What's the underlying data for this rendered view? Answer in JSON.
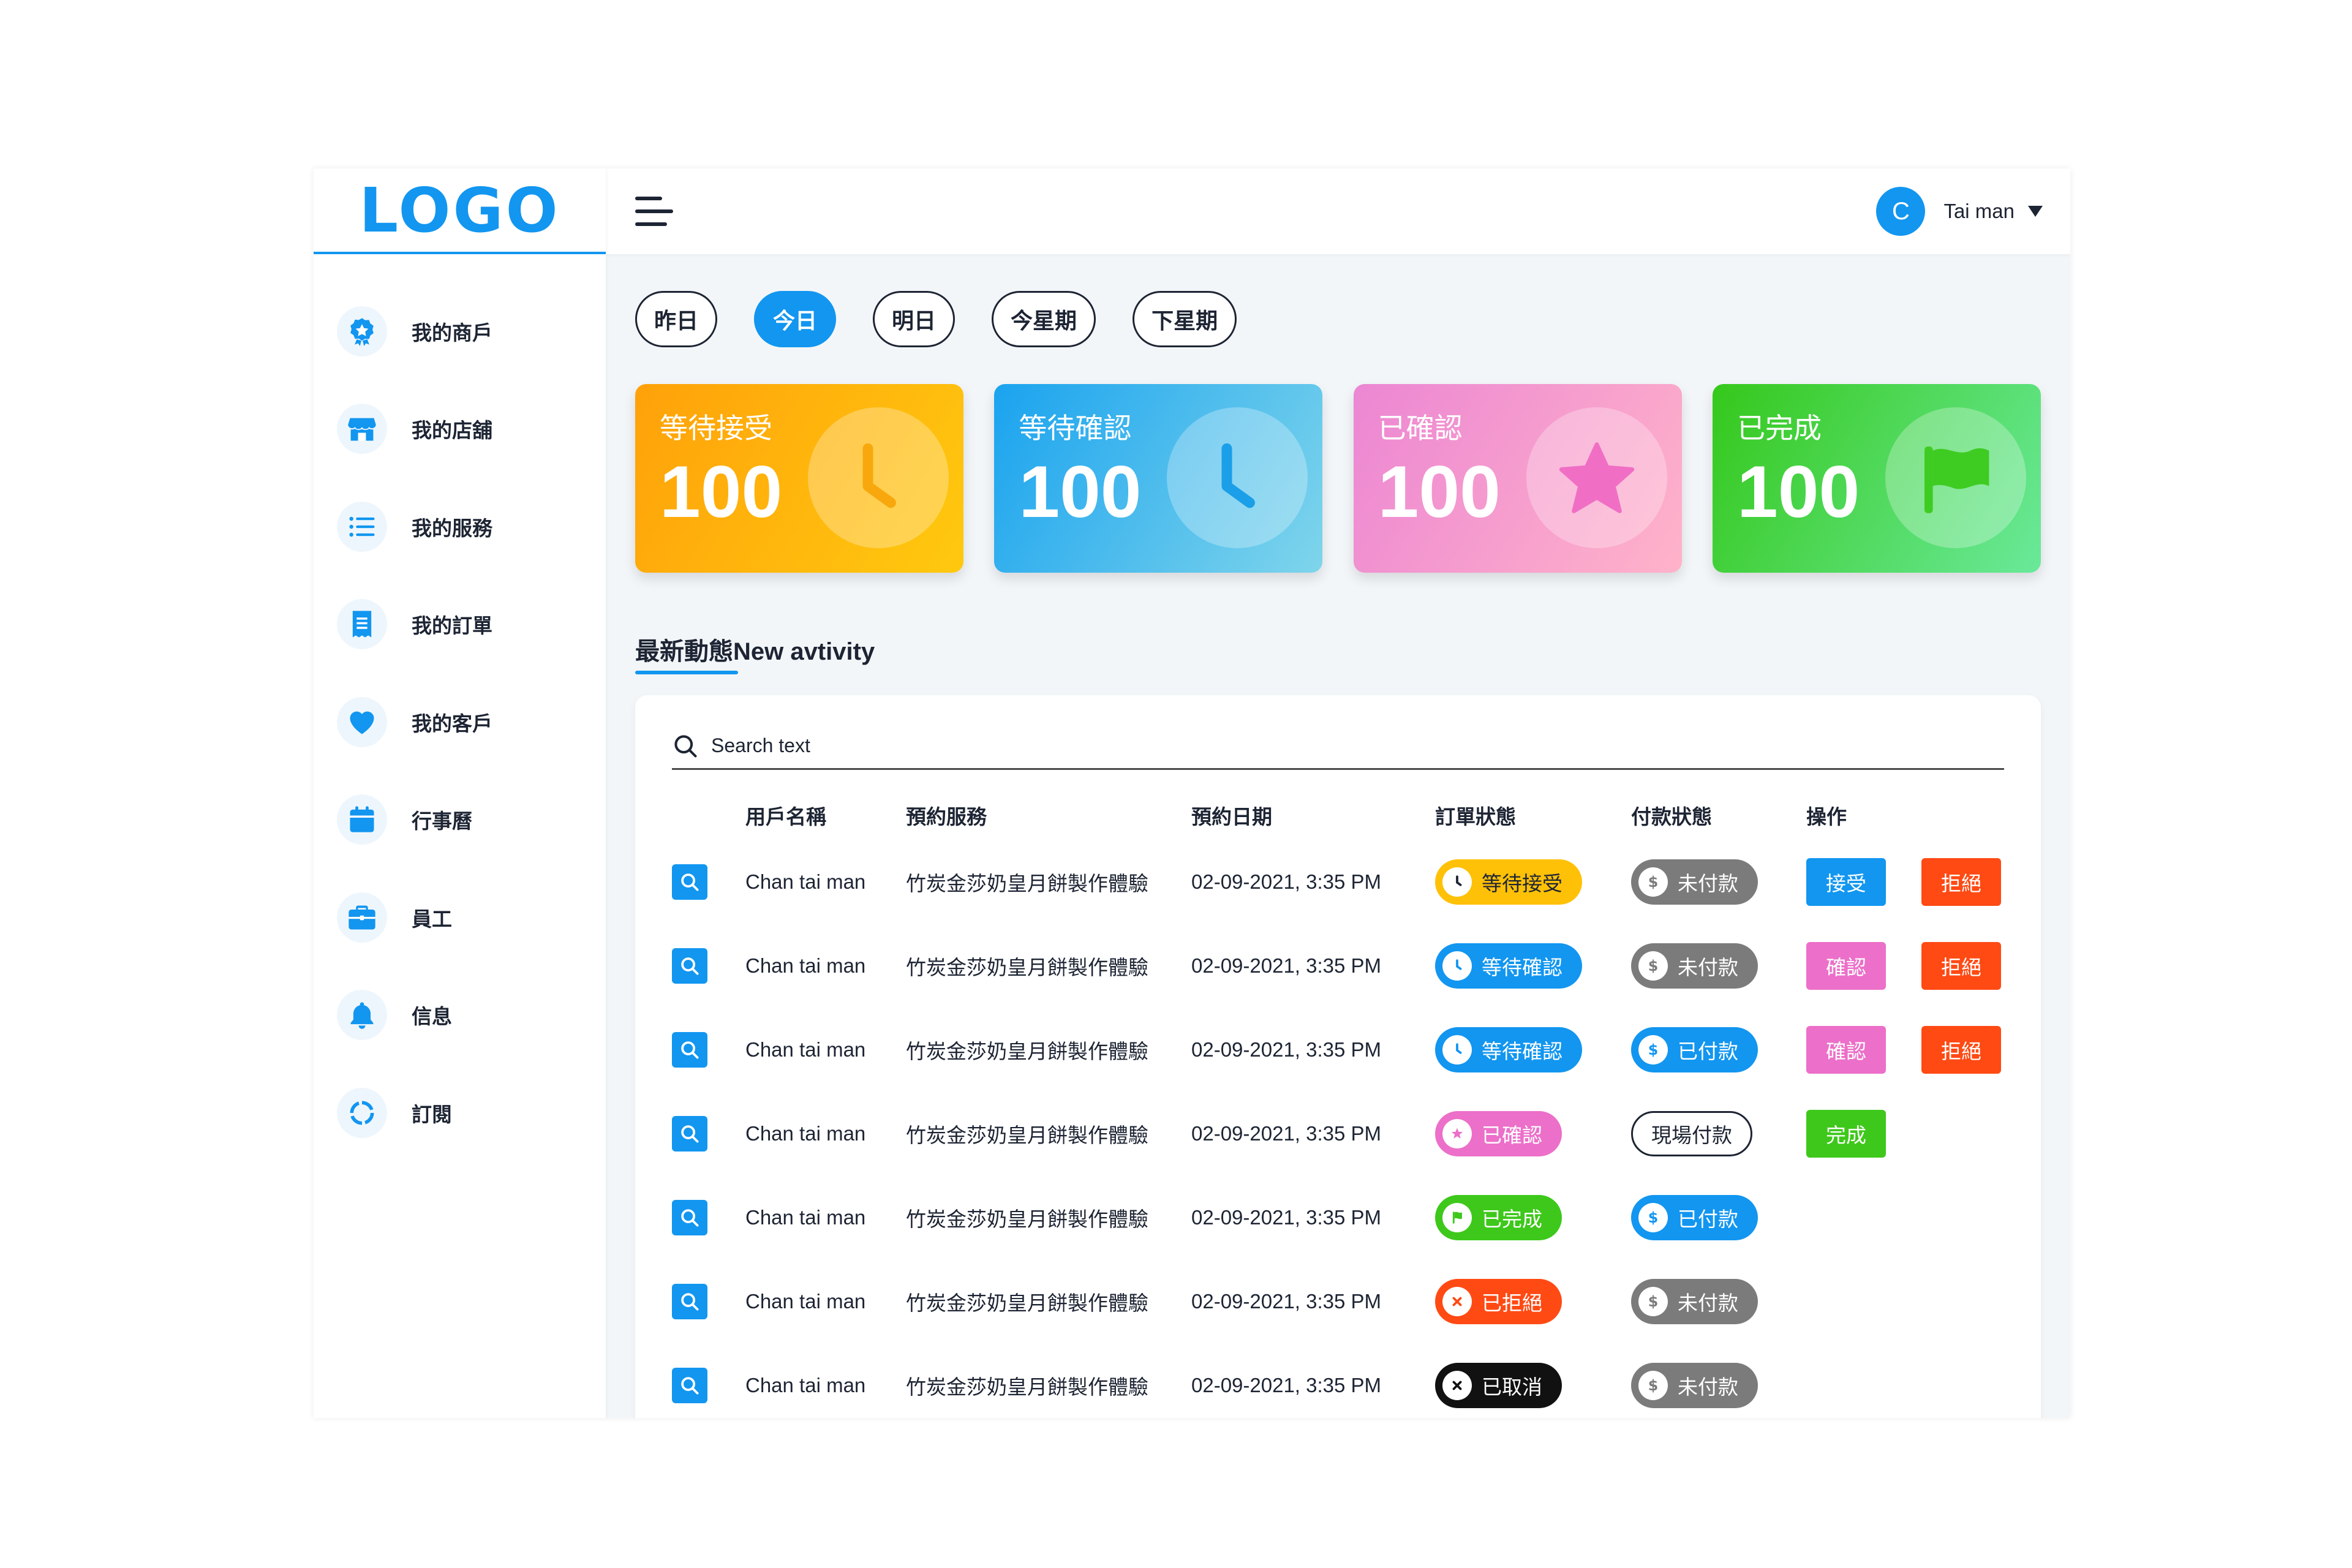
{
  "brand": {
    "logo": "LOGO"
  },
  "sidebar": {
    "items": [
      {
        "label": "我的商戶",
        "icon": "badge-icon"
      },
      {
        "label": "我的店舖",
        "icon": "store-icon"
      },
      {
        "label": "我的服務",
        "icon": "list-icon"
      },
      {
        "label": "我的訂單",
        "icon": "receipt-icon"
      },
      {
        "label": "我的客戶",
        "icon": "heart-icon"
      },
      {
        "label": "行事曆",
        "icon": "calendar-icon"
      },
      {
        "label": "員工",
        "icon": "briefcase-icon"
      },
      {
        "label": "信息",
        "icon": "bell-icon"
      },
      {
        "label": "訂閱",
        "icon": "refresh-icon"
      }
    ]
  },
  "header": {
    "avatar_initial": "C",
    "user_name": "Tai man"
  },
  "periods": [
    "昨日",
    "今日",
    "明日",
    "今星期",
    "下星期"
  ],
  "active_period": "今日",
  "stats": [
    {
      "label": "等待接受",
      "value": "100",
      "icon": "clock-icon"
    },
    {
      "label": "等待確認",
      "value": "100",
      "icon": "clock-icon"
    },
    {
      "label": "已確認",
      "value": "100",
      "icon": "star-icon"
    },
    {
      "label": "已完成",
      "value": "100",
      "icon": "flag-icon"
    }
  ],
  "activity": {
    "title": "最新動態New avtivity",
    "search_placeholder": "Search text",
    "columns": [
      "用戶名稱",
      "預約服務",
      "預約日期",
      "訂單狀態",
      "付款狀態",
      "操作"
    ],
    "rows": [
      {
        "user": "Chan tai man",
        "service": "竹炭金莎奶皇月餅製作體驗",
        "date": "02-09-2021, 3:35 PM",
        "order_status": "等待接受",
        "payment_status": "未付款",
        "actions": [
          "接受",
          "拒絕"
        ]
      },
      {
        "user": "Chan tai man",
        "service": "竹炭金莎奶皇月餅製作體驗",
        "date": "02-09-2021, 3:35 PM",
        "order_status": "等待確認",
        "payment_status": "未付款",
        "actions": [
          "確認",
          "拒絕"
        ]
      },
      {
        "user": "Chan tai man",
        "service": "竹炭金莎奶皇月餅製作體驗",
        "date": "02-09-2021, 3:35 PM",
        "order_status": "等待確認",
        "payment_status": "已付款",
        "actions": [
          "確認",
          "拒絕"
        ]
      },
      {
        "user": "Chan tai man",
        "service": "竹炭金莎奶皇月餅製作體驗",
        "date": "02-09-2021, 3:35 PM",
        "order_status": "已確認",
        "payment_status": "現場付款",
        "actions": [
          "完成"
        ]
      },
      {
        "user": "Chan tai man",
        "service": "竹炭金莎奶皇月餅製作體驗",
        "date": "02-09-2021, 3:35 PM",
        "order_status": "已完成",
        "payment_status": "已付款",
        "actions": []
      },
      {
        "user": "Chan tai man",
        "service": "竹炭金莎奶皇月餅製作體驗",
        "date": "02-09-2021, 3:35 PM",
        "order_status": "已拒絕",
        "payment_status": "未付款",
        "actions": []
      },
      {
        "user": "Chan tai man",
        "service": "竹炭金莎奶皇月餅製作體驗",
        "date": "02-09-2021, 3:35 PM",
        "order_status": "已取消",
        "payment_status": "未付款",
        "actions": []
      }
    ]
  },
  "colors": {
    "primary": "#1296f0",
    "awaiting_accept": "#ffc107",
    "awaiting_confirm": "#1296f0",
    "confirmed": "#ec6fc9",
    "completed": "#3ec81b",
    "rejected": "#ff4a14",
    "cancelled": "#111111",
    "unpaid": "#7b7b7b",
    "paid": "#1296f0"
  }
}
